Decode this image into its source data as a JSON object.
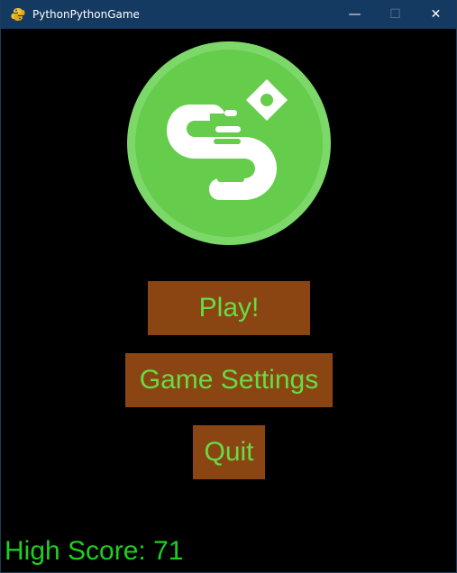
{
  "window": {
    "title": "PythonPythonGame",
    "app_icon": "pygame-snake-icon",
    "controls": {
      "minimize": "—",
      "maximize": "☐",
      "close": "✕"
    }
  },
  "logo": {
    "icon": "snake-logo-icon",
    "colors": {
      "ring": "#7dd86a",
      "fill": "#66cc4c",
      "snake": "#ffffff"
    }
  },
  "menu": {
    "play_label": "Play!",
    "settings_label": "Game Settings",
    "quit_label": "Quit",
    "button_bg": "#8b4513",
    "button_text_color": "#66dd44"
  },
  "footer": {
    "high_score": "High Score: 71",
    "text_color": "#22cc22"
  }
}
